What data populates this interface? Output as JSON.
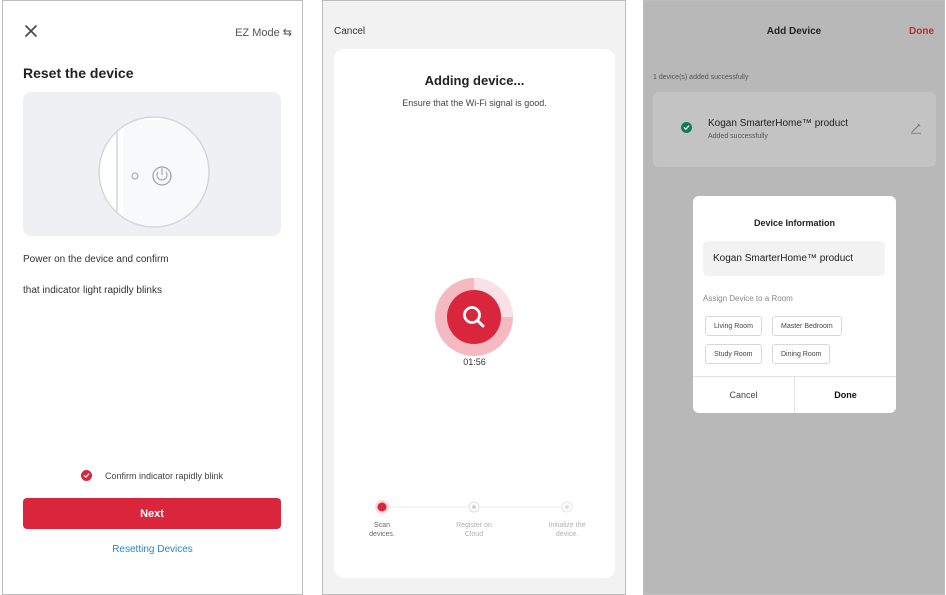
{
  "screen1": {
    "close_icon": "close-icon",
    "mode_label": "EZ Mode",
    "mode_icon": "swap-arrows-icon",
    "title": "Reset the device",
    "instruction_line1": "Power on the device and confirm",
    "instruction_line2": "that indicator light rapidly blinks",
    "confirm_label": "Confirm indicator rapidly blink",
    "confirm_checked": true,
    "next_label": "Next",
    "resetting_link": "Resetting Devices",
    "accent_color": "#d9263c",
    "link_color": "#2b84d8"
  },
  "screen2": {
    "cancel_label": "Cancel",
    "title": "Adding device...",
    "subtitle": "Ensure that the Wi-Fi signal is good.",
    "timer": "01:56",
    "steps": [
      {
        "label_line1": "Scan",
        "label_line2": "devices.",
        "active": true
      },
      {
        "label_line1": "Register on",
        "label_line2": "Cloud",
        "active": false
      },
      {
        "label_line1": "Initialize the",
        "label_line2": "device.",
        "active": false
      }
    ],
    "accent_color": "#d9263c"
  },
  "screen3": {
    "title": "Add Device",
    "done_label": "Done",
    "added_summary": "1 device(s) added successfully",
    "device_name": "Kogan SmarterHome™ product",
    "device_status": "Added successfully",
    "modal": {
      "title": "Device Information",
      "name_value": "Kogan SmarterHome™ product",
      "assign_label": "Assign Device to a Room",
      "rooms": [
        "Living Room",
        "Master Bedroom",
        "Study Room",
        "Dining Room"
      ],
      "cancel_label": "Cancel",
      "done_label": "Done"
    },
    "success_color": "#0f7c55",
    "done_color": "#c42a2a"
  }
}
